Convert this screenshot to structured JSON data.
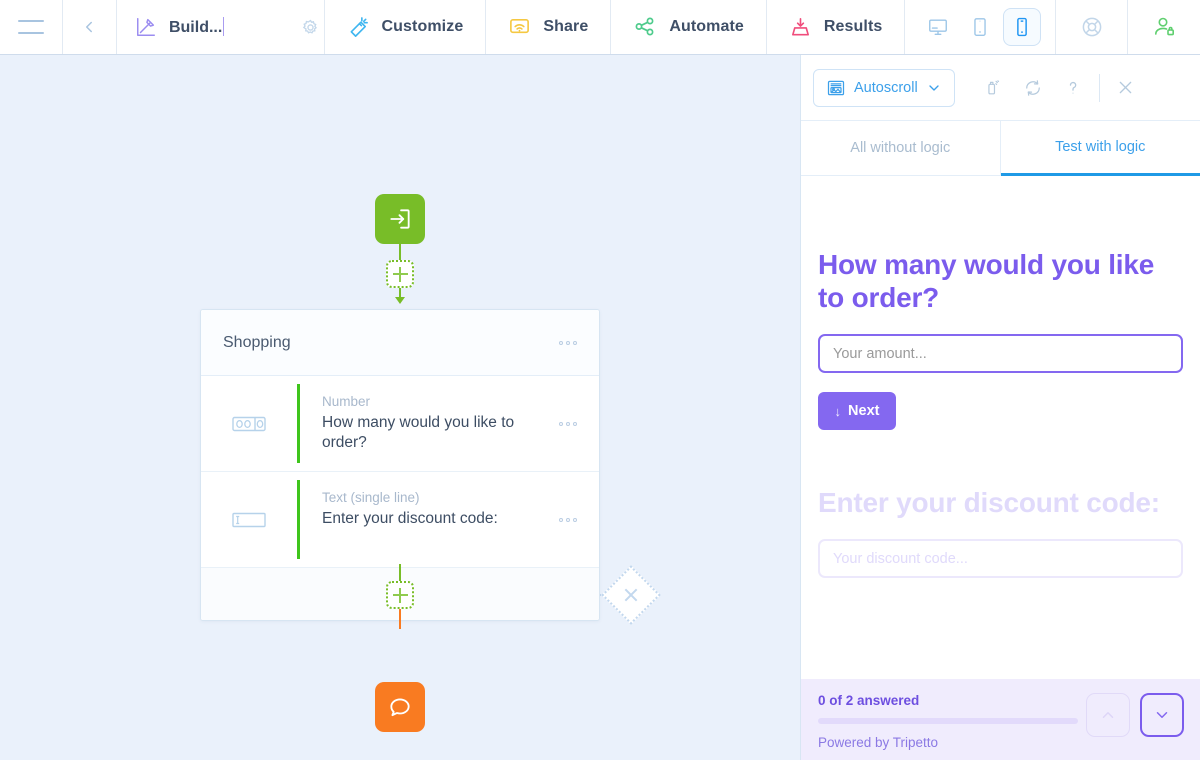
{
  "topbar": {
    "menu_icon": "hamburger-menu-icon",
    "back_icon": "chevron-left-icon",
    "build": {
      "icon": "build-pencil-icon",
      "name": "Build...",
      "gear_icon": "gear-icon"
    },
    "tabs": [
      {
        "label": "Customize",
        "icon": "magic-wand-icon"
      },
      {
        "label": "Share",
        "icon": "share-screen-icon"
      },
      {
        "label": "Automate",
        "icon": "automate-nodes-icon"
      },
      {
        "label": "Results",
        "icon": "results-inbox-icon"
      }
    ],
    "devices": [
      {
        "name": "desktop-preview",
        "icon": "desktop-icon",
        "selected": false
      },
      {
        "name": "tablet-preview",
        "icon": "tablet-icon",
        "selected": false
      },
      {
        "name": "mobile-preview",
        "icon": "mobile-icon",
        "selected": true
      }
    ],
    "help_icon": "lifebuoy-help-icon",
    "account_icon": "user-lock-icon"
  },
  "canvas": {
    "start_node": {
      "name": "start-node",
      "icon": "enter-arrow-icon",
      "color": "#78bd28"
    },
    "chat_node": {
      "name": "chat-node",
      "icon": "speech-bubble-icon",
      "color": "#f97b21"
    },
    "add_top": {
      "name": "add-block-top",
      "icon": "plus-icon"
    },
    "add_bottom": {
      "name": "add-block-bottom",
      "icon": "plus-icon"
    },
    "branch_diamond": {
      "name": "add-branch-diamond",
      "icon": "plus-icon"
    },
    "card": {
      "title": "Shopping",
      "menu_icon": "ellipsis-icon",
      "rows": [
        {
          "type": "Number",
          "question": "How many would you like to order?",
          "icon": "number-field-icon",
          "menu_icon": "ellipsis-icon"
        },
        {
          "type": "Text (single line)",
          "question": "Enter your discount code:",
          "icon": "text-field-icon",
          "menu_icon": "ellipsis-icon"
        }
      ],
      "add_label_icon": "plus-icon"
    }
  },
  "panel": {
    "toolbar": {
      "autoscroll_label": "Autoscroll",
      "autoscroll_icon": "autoscroll-icon",
      "chevron_icon": "chevron-down-icon",
      "actions": [
        {
          "name": "snapshot-button",
          "icon": "snapshot-icon"
        },
        {
          "name": "restart-button",
          "icon": "refresh-icon"
        },
        {
          "name": "help-button",
          "icon": "question-mark-icon"
        },
        {
          "name": "close-button",
          "icon": "close-x-icon"
        }
      ]
    },
    "tabs": [
      {
        "label": "All without logic",
        "active": false
      },
      {
        "label": "Test with logic",
        "active": true
      }
    ],
    "form": {
      "question1": {
        "title": "How many would you like to order?",
        "placeholder": "Your amount...",
        "next_label": "Next",
        "next_icon": "down-arrow-icon"
      },
      "question2": {
        "title": "Enter your discount code:",
        "placeholder": "Your discount code..."
      },
      "footer": {
        "progress_text": "0 of 2 answered",
        "progress_percent": 0,
        "powered_by": "Powered by Tripetto",
        "prev_icon": "chevron-up-icon",
        "next_icon": "chevron-down-icon"
      }
    }
  },
  "colors": {
    "canvas_bg": "#eaf1fb",
    "accent_purple": "#7b5ced",
    "accent_blue": "#1f9ae6",
    "green": "#78bd28",
    "orange": "#f97b21"
  }
}
